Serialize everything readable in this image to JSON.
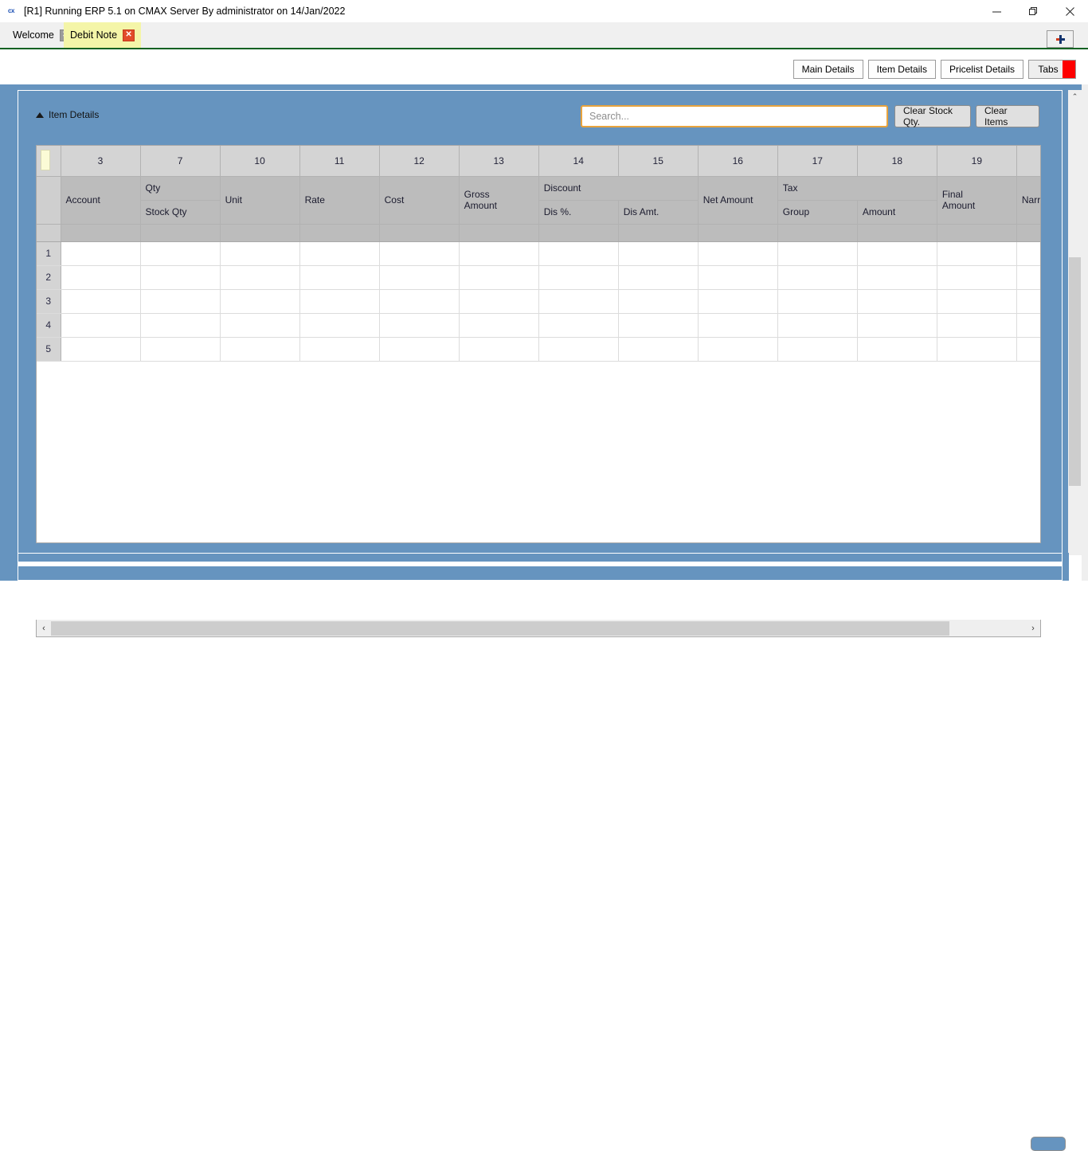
{
  "window": {
    "title": "[R1] Running ERP 5.1 on CMAX Server By administrator on 14/Jan/2022",
    "app_icon": "cx",
    "controls": {
      "minimize": "minimize-icon",
      "restore": "restore-icon",
      "close": "close-icon"
    }
  },
  "tabs": {
    "items": [
      {
        "label": "Welcome",
        "active": false,
        "close_icon": "✕"
      },
      {
        "label": "Debit Note",
        "active": true,
        "close_icon": "✕"
      }
    ],
    "add_tab_label": "+"
  },
  "toolbar": {
    "buttons": [
      {
        "label": "Main Details"
      },
      {
        "label": "Item Details"
      },
      {
        "label": "Pricelist Details"
      },
      {
        "label": "Tabs"
      }
    ]
  },
  "panel": {
    "title": "Item Details",
    "collapse_icon": "triangle-up-icon",
    "search": {
      "value": "",
      "placeholder": "Search..."
    },
    "clear_stock_qty_label": "Clear Stock Qty.",
    "clear_items_label": "Clear Items"
  },
  "grid": {
    "column_numbers": [
      "3",
      "7",
      "10",
      "11",
      "12",
      "13",
      "14",
      "15",
      "16",
      "17",
      "18",
      "19",
      ""
    ],
    "headers": [
      {
        "label": "Account",
        "sub": ""
      },
      {
        "label": "Qty",
        "sub": "Stock Qty"
      },
      {
        "label": "Unit",
        "sub": ""
      },
      {
        "label": "Rate",
        "sub": ""
      },
      {
        "label": "Cost",
        "sub": ""
      },
      {
        "label": "Gross Amount",
        "sub": ""
      },
      {
        "label": "Discount",
        "sub": "Dis %."
      },
      {
        "label": "",
        "sub": "Dis Amt."
      },
      {
        "label": "Net Amount",
        "sub": ""
      },
      {
        "label": "Tax",
        "sub": "Group"
      },
      {
        "label": "",
        "sub": "Amount"
      },
      {
        "label": "Final Amount",
        "sub": ""
      },
      {
        "label": "Narrat",
        "sub": ""
      }
    ],
    "row_numbers": [
      "1",
      "2",
      "3",
      "4",
      "5"
    ],
    "rows": [
      [
        "",
        "",
        "",
        "",
        "",
        "",
        "",
        "",
        "",
        "",
        "",
        "",
        ""
      ],
      [
        "",
        "",
        "",
        "",
        "",
        "",
        "",
        "",
        "",
        "",
        "",
        "",
        ""
      ],
      [
        "",
        "",
        "",
        "",
        "",
        "",
        "",
        "",
        "",
        "",
        "",
        "",
        ""
      ],
      [
        "",
        "",
        "",
        "",
        "",
        "",
        "",
        "",
        "",
        "",
        "",
        "",
        ""
      ],
      [
        "",
        "",
        "",
        "",
        "",
        "",
        "",
        "",
        "",
        "",
        "",
        "",
        ""
      ]
    ]
  },
  "scrollbars": {
    "horizontal": {
      "left_arrow": "‹",
      "right_arrow": "›"
    },
    "vertical": {
      "up_arrow": "⌃",
      "down_arrow": "⌄"
    }
  },
  "colors": {
    "panel_blue": "#6694bf",
    "active_tab_yellow": "#f4f5a8",
    "tab_underline_green": "#0b6121",
    "search_border_orange": "#e8a33d",
    "tabs_marker_red": "#fe0000",
    "close_red": "#e24b2a"
  }
}
